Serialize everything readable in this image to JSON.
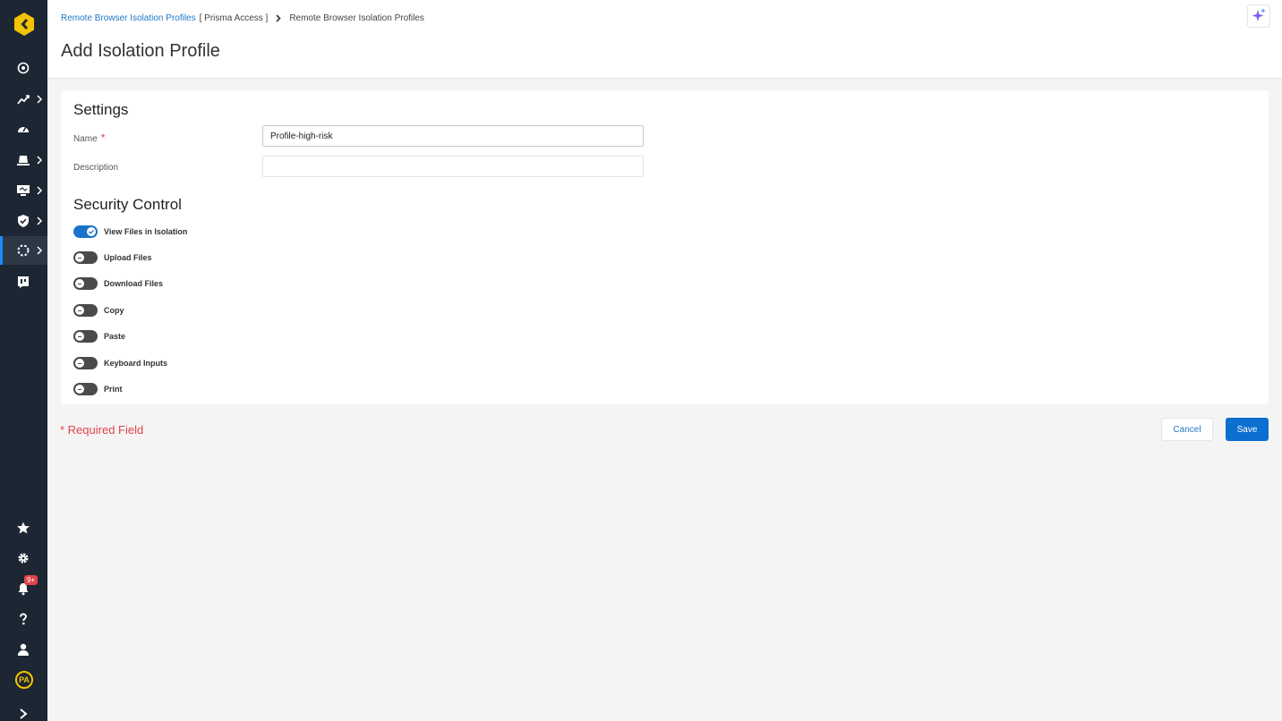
{
  "breadcrumb": {
    "parent_link": "Remote Browser Isolation Profiles",
    "parent_context": "[ Prisma Access ]",
    "current": "Remote Browser Isolation Profiles"
  },
  "page_title": "Add Isolation Profile",
  "settings": {
    "title": "Settings",
    "name_label": "Name",
    "name_required": "*",
    "name_value": "Profile-high-risk",
    "description_label": "Description",
    "description_value": ""
  },
  "security_control": {
    "title": "Security Control",
    "toggles": [
      {
        "label": "View Files in Isolation",
        "on": true
      },
      {
        "label": "Upload Files",
        "on": false
      },
      {
        "label": "Download Files",
        "on": false
      },
      {
        "label": "Copy",
        "on": false
      },
      {
        "label": "Paste",
        "on": false
      },
      {
        "label": "Keyboard Inputs",
        "on": false
      },
      {
        "label": "Print",
        "on": false
      }
    ]
  },
  "footer": {
    "required_note": "* Required Field",
    "cancel_label": "Cancel",
    "save_label": "Save"
  },
  "sidebar": {
    "notification_count": "9+",
    "user_initials": "PA"
  },
  "colors": {
    "accent": "#1a73c9",
    "sidebar_bg": "#1d2733",
    "required": "#e2434a",
    "logo": "#f3c400"
  }
}
